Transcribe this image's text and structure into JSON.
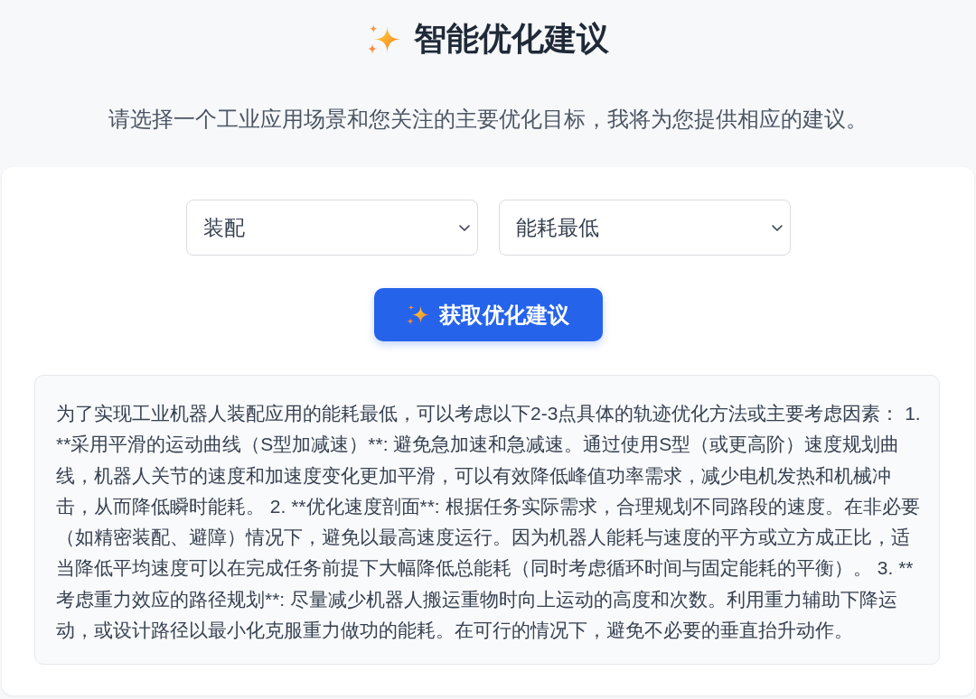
{
  "header": {
    "title": "智能优化建议",
    "subtitle": "请选择一个工业应用场景和您关注的主要优化目标，我将为您提供相应的建议。"
  },
  "form": {
    "selects": [
      {
        "value": "装配"
      },
      {
        "value": "能耗最低"
      }
    ],
    "button": {
      "label": "获取优化建议"
    }
  },
  "result": {
    "text": "为了实现工业机器人装配应用的能耗最低，可以考虑以下2-3点具体的轨迹优化方法或主要考虑因素： 1. **采用平滑的运动曲线（S型加减速）**: 避免急加速和急减速。通过使用S型（或更高阶）速度规划曲线，机器人关节的速度和加速度变化更加平滑，可以有效降低峰值功率需求，减少电机发热和机械冲击，从而降低瞬时能耗。 2. **优化速度剖面**: 根据任务实际需求，合理规划不同路段的速度。在非必要（如精密装配、避障）情况下，避免以最高速度运行。因为机器人能耗与速度的平方或立方成正比，适当降低平均速度可以在完成任务前提下大幅降低总能耗（同时考虑循环时间与固定能耗的平衡）。 3. **考虑重力效应的路径规划**: 尽量减少机器人搬运重物时向上运动的高度和次数。利用重力辅助下降运动，或设计路径以最小化克服重力做功的能耗。在可行的情况下，避免不必要的垂直抬升动作。"
  }
}
